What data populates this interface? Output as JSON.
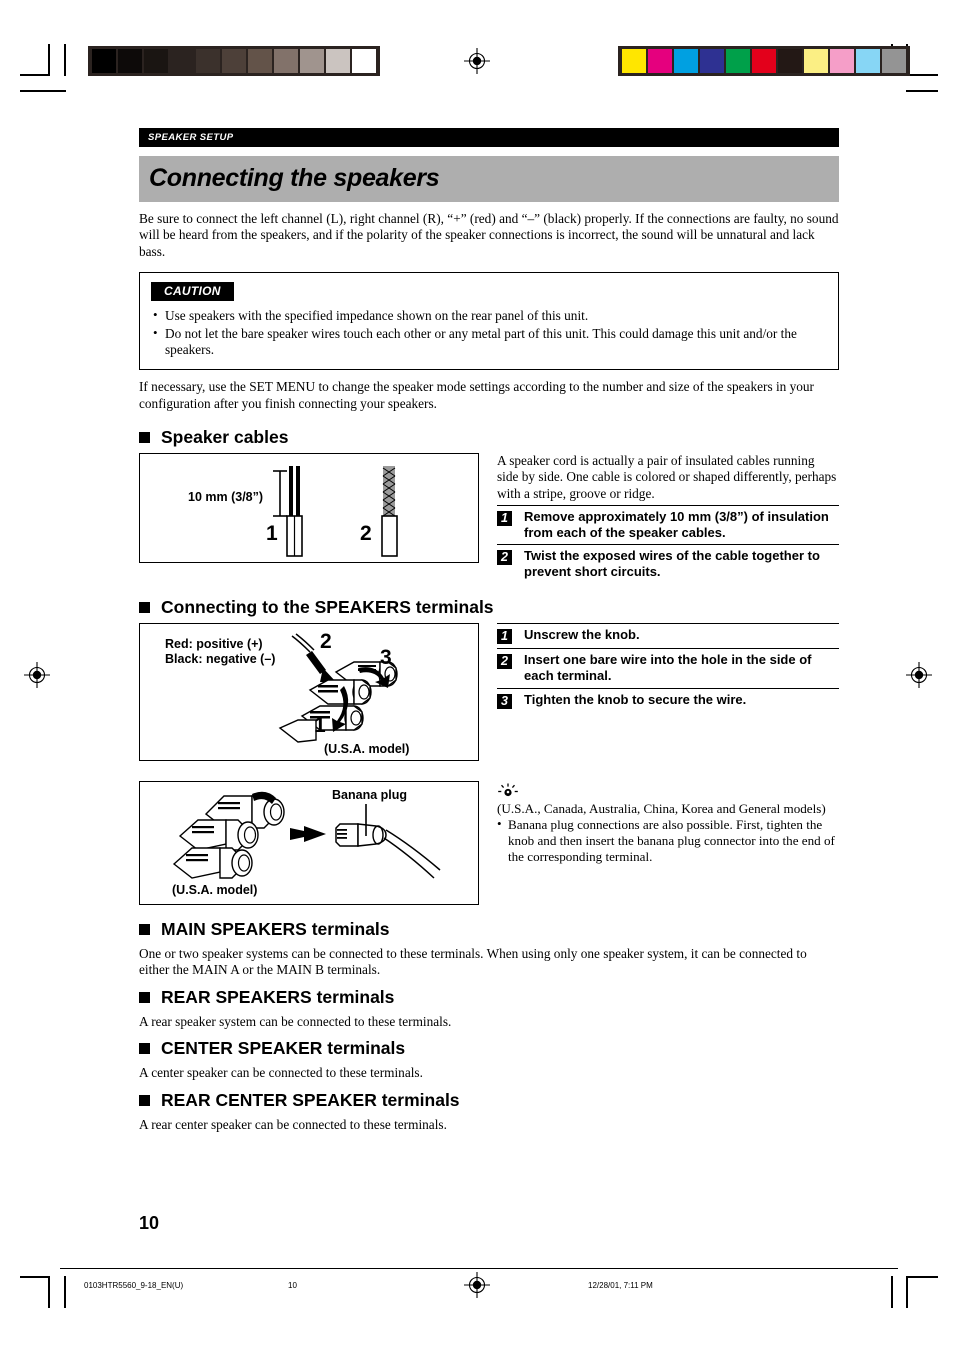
{
  "running_head": "SPEAKER SETUP",
  "chapter_title": "Connecting the speakers",
  "intro_paragraph": "Be sure to connect the left channel (L), right channel (R), “+” (red) and “–” (black) properly. If the connections are faulty, no sound will be heard from the speakers, and if the polarity of the speaker connections is incorrect, the sound will be unnatural and lack bass.",
  "caution": {
    "label": "CAUTION",
    "items": [
      "Use speakers with the specified impedance shown on the rear panel of this unit.",
      "Do not let the bare speaker wires touch each other or any metal part of this unit. This could damage this unit and/or the speakers."
    ]
  },
  "set_menu_paragraph": "If necessary, use the SET MENU to change the speaker mode settings according to the number and size of the speakers in your configuration after you finish connecting your speakers.",
  "speaker_cables": {
    "heading": "Speaker cables",
    "figure": {
      "measurement_label": "10 mm (3/8”)",
      "num_1": "1",
      "num_2": "2"
    },
    "description": "A speaker cord is actually a pair of insulated cables running side by side. One cable is colored or shaped differently, perhaps with a stripe, groove or ridge.",
    "steps": [
      {
        "num": "1",
        "text": "Remove approximately 10 mm (3/8”) of insulation from each of the speaker cables."
      },
      {
        "num": "2",
        "text": "Twist the exposed wires of the cable together to prevent short circuits."
      }
    ]
  },
  "speakers_terminals": {
    "heading": "Connecting to the SPEAKERS terminals",
    "figure": {
      "polarity_red": "Red: positive (+)",
      "polarity_black": "Black: negative (–)",
      "model_caption": "(U.S.A. model)",
      "num_1": "1",
      "num_2": "2",
      "num_3": "3"
    },
    "steps": [
      {
        "num": "1",
        "text": "Unscrew the knob."
      },
      {
        "num": "2",
        "text": "Insert one bare wire into the hole in the side of each terminal."
      },
      {
        "num": "3",
        "text": "Tighten the knob to secure the wire."
      }
    ]
  },
  "banana_plug": {
    "figure": {
      "callout": "Banana plug",
      "model_caption": "(U.S.A. model)"
    },
    "tip_models": "(U.S.A., Canada, Australia, China, Korea and General models)",
    "tip_items": [
      "Banana plug connections are also possible. First, tighten the knob and then insert the banana plug connector into the end of the corresponding terminal."
    ]
  },
  "terminal_sections": [
    {
      "heading": "MAIN SPEAKERS terminals",
      "body": "One or two speaker systems can be connected to these terminals. When using only one speaker system, it can be connected to either the MAIN A or the MAIN B terminals."
    },
    {
      "heading": "REAR SPEAKERS terminals",
      "body": "A rear speaker system can be connected to these terminals."
    },
    {
      "heading": "CENTER SPEAKER terminals",
      "body": "A center speaker can be connected to these terminals."
    },
    {
      "heading": "REAR CENTER SPEAKER terminals",
      "body": "A rear center speaker can be connected to these terminals."
    }
  ],
  "page_number": "10",
  "footer": {
    "file_id": "0103HTR5560_9-18_EN(U)",
    "page": "10",
    "timestamp": "12/28/01, 7:11 PM"
  },
  "print_marks": {
    "grayscale_swatches": [
      "#000000",
      "#0d0a09",
      "#1a1512",
      "#2b2320",
      "#3b312c",
      "#4d4039",
      "#635349",
      "#82726a",
      "#a0948e",
      "#cbc4c0",
      "#ffffff"
    ],
    "color_swatches": [
      "#ffe600",
      "#e5007e",
      "#00a0e1",
      "#2e3192",
      "#00a04a",
      "#e3001b",
      "#231815",
      "#fbef84",
      "#f59ec8",
      "#87d6f5",
      "#949494"
    ]
  }
}
